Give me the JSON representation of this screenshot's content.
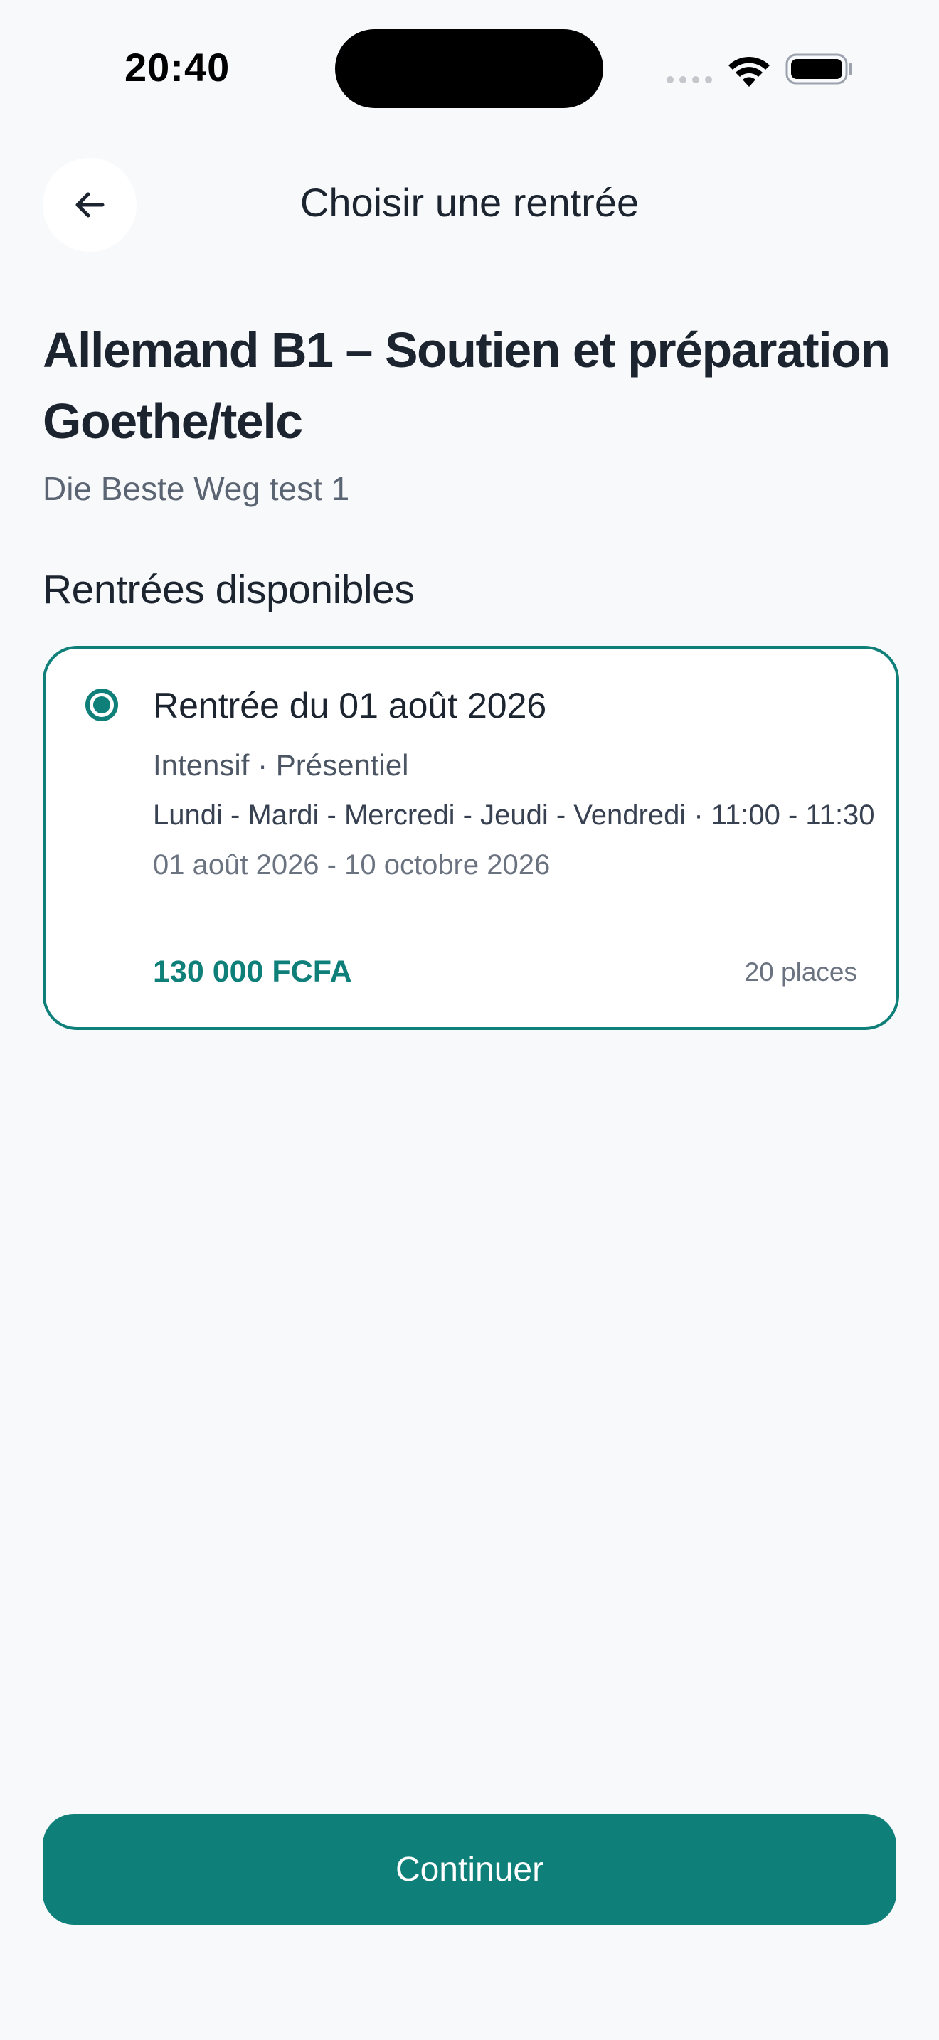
{
  "status_bar": {
    "time": "20:40"
  },
  "header": {
    "title": "Choisir une rentrée",
    "back_icon": "arrow-left-icon"
  },
  "course": {
    "title": "Allemand B1 – Soutien et préparation Goethe/telc",
    "school": "Die Beste Weg test 1"
  },
  "sessions_section": {
    "title": "Rentrées disponibles",
    "items": [
      {
        "selected": true,
        "title": "Rentrée du 01 août 2026",
        "format": "Intensif · Présentiel",
        "schedule": "Lundi - Mardi - Mercredi - Jeudi - Vendredi · 11:00 - 11:30",
        "dates": "01 août 2026 - 10 octobre 2026",
        "price": "130 000 FCFA",
        "places": "20 places"
      }
    ]
  },
  "actions": {
    "continue_label": "Continuer"
  },
  "colors": {
    "accent": "#0e7f79",
    "background": "#f8f9fb",
    "text": "#1c2430"
  }
}
